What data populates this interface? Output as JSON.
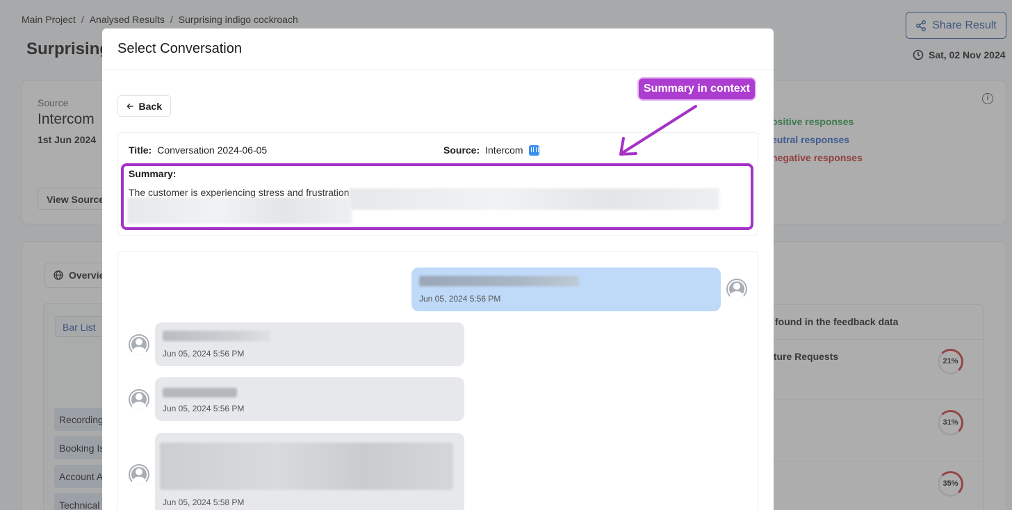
{
  "breadcrumb": {
    "items": [
      "Main Project",
      "Analysed Results",
      "Surprising indigo cockroach"
    ],
    "separator": "/"
  },
  "page": {
    "title": "Surprising",
    "share_label": "Share Result",
    "date": "Sat, 02 Nov 2024"
  },
  "source_card": {
    "label": "Source",
    "value": "Intercom",
    "date": "1st Jun 2024",
    "view_source_label": "View Source",
    "responses": {
      "positive": "ositive responses",
      "neutral": "eutral responses",
      "negative": "negative responses"
    }
  },
  "overview": {
    "tab_label": "Overvie",
    "bar_list_label": "Bar List",
    "bar_items": [
      "Recording",
      "Booking Is",
      "Account A",
      "Technical"
    ]
  },
  "feedback_panel": {
    "title": "found in the feedback data",
    "first_item": "ature Requests",
    "percentages": [
      "21%",
      "31%",
      "35%"
    ]
  },
  "modal": {
    "title": "Select Conversation",
    "back_label": "Back",
    "title_label": "Title:",
    "title_value": "Conversation 2024-06-05",
    "source_label": "Source:",
    "source_value": "Intercom",
    "summary_label": "Summary:",
    "summary_text": "The customer is experiencing stress and frustration"
  },
  "annotation": {
    "label": "Summary in context",
    "color": "#ad3cd0"
  },
  "messages": [
    {
      "direction": "outgoing",
      "timestamp": "Jun 05, 2024 5:56 PM"
    },
    {
      "direction": "incoming",
      "timestamp": "Jun 05, 2024 5:56 PM"
    },
    {
      "direction": "incoming",
      "timestamp": "Jun 05, 2024 5:56 PM"
    },
    {
      "direction": "incoming",
      "timestamp": "Jun 05, 2024 5:58 PM"
    }
  ]
}
